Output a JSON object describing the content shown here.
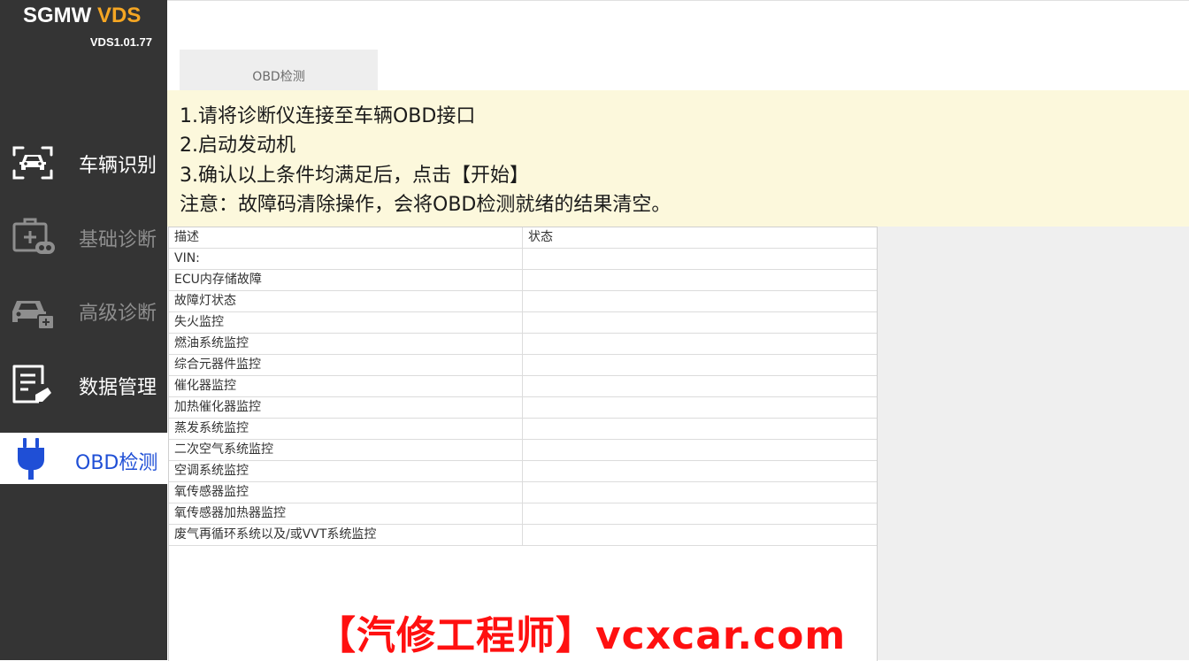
{
  "app": {
    "brand_prefix": "SGMW ",
    "brand_suffix": "VDS",
    "version": "VDS1.01.77"
  },
  "sidebar": {
    "items": [
      {
        "label": "车辆识别",
        "icon": "car-scan-icon",
        "state": "enabled"
      },
      {
        "label": "基础诊断",
        "icon": "medical-kit-icon",
        "state": "disabled"
      },
      {
        "label": "高级诊断",
        "icon": "car-lock-icon",
        "state": "disabled"
      },
      {
        "label": "数据管理",
        "icon": "document-edit-icon",
        "state": "enabled"
      },
      {
        "label": "OBD检测",
        "icon": "plug-icon",
        "state": "active"
      }
    ]
  },
  "tabs": [
    {
      "label": "OBD检测"
    }
  ],
  "notice": {
    "lines": [
      "1.请将诊断仪连接至车辆OBD接口",
      "2.启动发动机",
      "3.确认以上条件均满足后，点击【开始】",
      "注意：故障码清除操作，会将OBD检测就绪的结果清空。"
    ]
  },
  "table": {
    "headers": {
      "desc": "描述",
      "status": "状态"
    },
    "rows": [
      {
        "desc": "VIN:",
        "status": ""
      },
      {
        "desc": "ECU内存储故障",
        "status": ""
      },
      {
        "desc": "故障灯状态",
        "status": ""
      },
      {
        "desc": "失火监控",
        "status": ""
      },
      {
        "desc": "燃油系统监控",
        "status": ""
      },
      {
        "desc": "综合元器件监控",
        "status": ""
      },
      {
        "desc": "催化器监控",
        "status": ""
      },
      {
        "desc": "加热催化器监控",
        "status": ""
      },
      {
        "desc": "蒸发系统监控",
        "status": ""
      },
      {
        "desc": "二次空气系统监控",
        "status": ""
      },
      {
        "desc": "空调系统监控",
        "status": ""
      },
      {
        "desc": "氧传感器监控",
        "status": ""
      },
      {
        "desc": "氧传感器加热器监控",
        "status": ""
      },
      {
        "desc": "废气再循环系统以及/或VVT系统监控",
        "status": ""
      }
    ]
  },
  "watermark": "【汽修工程师】vcxcar.com",
  "colors": {
    "sidebar_bg": "#343434",
    "accent_blue": "#1f4fd6",
    "brand_orange": "#f5a623",
    "notice_bg": "#fcf8dc",
    "watermark_red": "#ff1010"
  }
}
